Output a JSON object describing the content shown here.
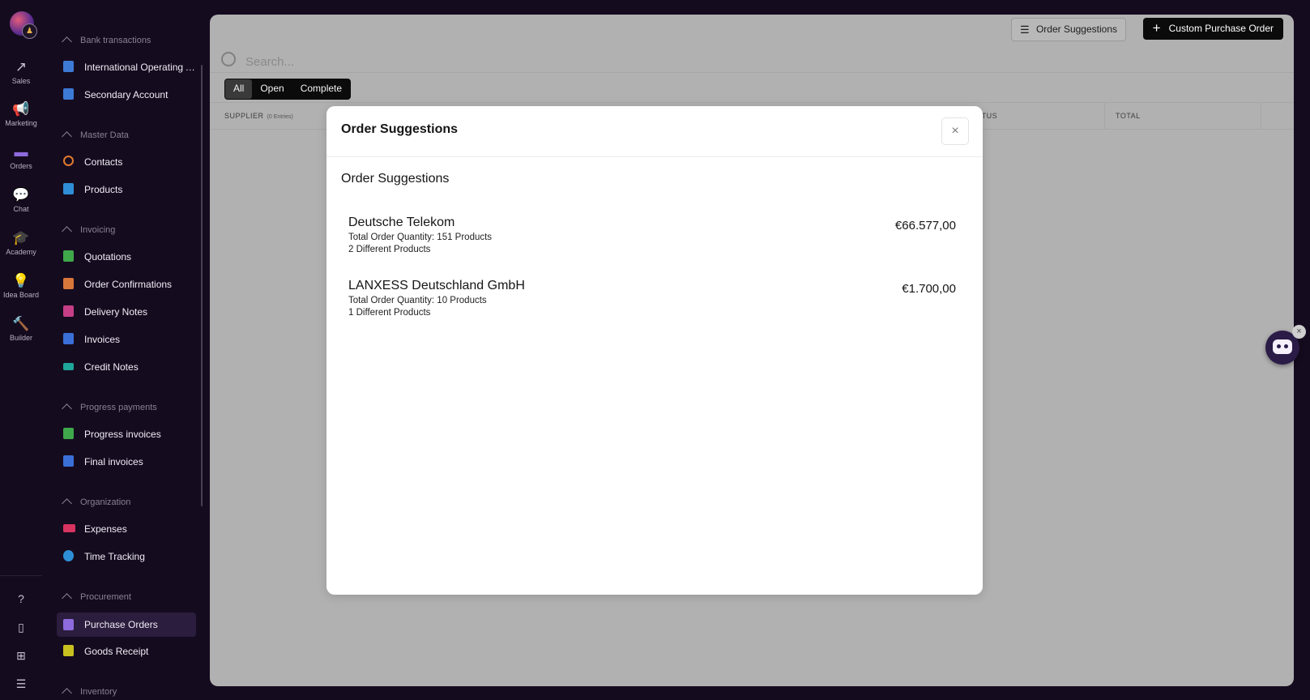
{
  "rail": {
    "items": [
      {
        "label": "Sales",
        "icon": "trending-up-icon",
        "glyph": "↗"
      },
      {
        "label": "Marketing",
        "icon": "megaphone-icon",
        "glyph": "📢"
      },
      {
        "label": "Orders",
        "icon": "orders-icon",
        "glyph": "▬"
      },
      {
        "label": "Chat",
        "icon": "chat-icon",
        "glyph": "💬"
      },
      {
        "label": "Academy",
        "icon": "graduation-cap-icon",
        "glyph": "🎓"
      },
      {
        "label": "Idea Board",
        "icon": "lightbulb-icon",
        "glyph": "💡"
      },
      {
        "label": "Builder",
        "icon": "hammer-icon",
        "glyph": "🔨"
      }
    ],
    "bottom": [
      {
        "icon": "help-icon",
        "glyph": "?"
      },
      {
        "icon": "mobile-icon",
        "glyph": "▯"
      },
      {
        "icon": "apps-grid-icon",
        "glyph": "⊞"
      },
      {
        "icon": "sliders-icon",
        "glyph": "☰"
      }
    ]
  },
  "nav": {
    "groups": {
      "bank": "Bank transactions",
      "master": "Master Data",
      "invoicing": "Invoicing",
      "progress": "Progress payments",
      "organization": "Organization",
      "procurement": "Procurement",
      "inventory": "Inventory"
    },
    "items": {
      "international": "International Operating Account",
      "secondary": "Secondary Account",
      "contacts": "Contacts",
      "products": "Products",
      "quotations": "Quotations",
      "order_confirmations": "Order Confirmations",
      "delivery_notes": "Delivery Notes",
      "invoices": "Invoices",
      "credit_notes": "Credit Notes",
      "progress_invoices": "Progress invoices",
      "final_invoices": "Final invoices",
      "expenses": "Expenses",
      "time_tracking": "Time Tracking",
      "purchase_orders": "Purchase Orders",
      "goods_receipt": "Goods Receipt"
    }
  },
  "toolbar": {
    "order_suggestions": "Order Suggestions",
    "custom_purchase_order": "Custom Purchase Order"
  },
  "search": {
    "placeholder": "Search..."
  },
  "filters": {
    "all": "All",
    "open": "Open",
    "complete": "Complete",
    "selected": "All"
  },
  "table": {
    "supplier": "SUPPLIER",
    "entries": "(0 Entries)",
    "status": "STATUS",
    "total": "TOTAL"
  },
  "modal": {
    "title": "Order Suggestions",
    "subtitle": "Order Suggestions",
    "close_glyph": "×",
    "suggestions": [
      {
        "supplier": "Deutsche Telekom",
        "quantity": "Total Order Quantity: 151 Products",
        "products": "2 Different Products",
        "amount": "€66.577,00"
      },
      {
        "supplier": "LANXESS Deutschland GmbH",
        "quantity": "Total Order Quantity: 10 Products",
        "products": "1 Different Products",
        "amount": "€1.700,00"
      }
    ]
  },
  "colors": {
    "background": "#150b1f",
    "accent": "#8d6bdc",
    "overlay": "#b1b1b1",
    "primary_button": "#0b0b0b"
  }
}
